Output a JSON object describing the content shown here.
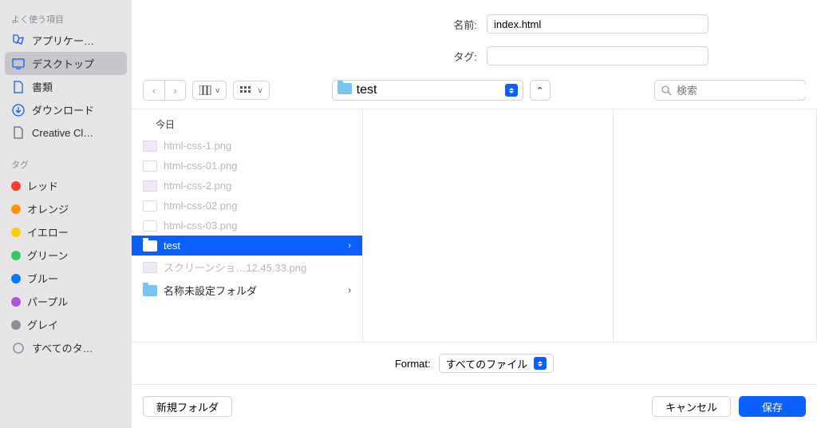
{
  "form": {
    "name_label": "名前:",
    "name_value": "index.html",
    "tag_label": "タグ:"
  },
  "sidebar": {
    "favorites_title": "よく使う項目",
    "favorites": [
      {
        "label": "アプリケー…",
        "icon": "app"
      },
      {
        "label": "デスクトップ",
        "icon": "desktop",
        "selected": true
      },
      {
        "label": "書類",
        "icon": "doc"
      },
      {
        "label": "ダウンロード",
        "icon": "download"
      },
      {
        "label": "Creative Cl…",
        "icon": "file"
      }
    ],
    "tags_title": "タグ",
    "tags": [
      {
        "label": "レッド",
        "color": "#ff3b30"
      },
      {
        "label": "オレンジ",
        "color": "#ff9500"
      },
      {
        "label": "イエロー",
        "color": "#ffcc00"
      },
      {
        "label": "グリーン",
        "color": "#34c759"
      },
      {
        "label": "ブルー",
        "color": "#007aff"
      },
      {
        "label": "パープル",
        "color": "#af52de"
      },
      {
        "label": "グレイ",
        "color": "#8e8e93"
      }
    ],
    "all_tags_label": "すべてのタ…"
  },
  "toolbar": {
    "location": "test",
    "search_placeholder": "検索"
  },
  "browser": {
    "header": "今日",
    "files": [
      {
        "name": "html-css-1.png",
        "type": "img",
        "dim": true
      },
      {
        "name": "html-css-01.png",
        "type": "imgw",
        "dim": true
      },
      {
        "name": "html-css-2.png",
        "type": "img",
        "dim": true
      },
      {
        "name": "html-css-02.png",
        "type": "imgw",
        "dim": true
      },
      {
        "name": "html-css-03.png",
        "type": "imgw",
        "dim": true
      },
      {
        "name": "test",
        "type": "folder",
        "selected": true
      },
      {
        "name": "スクリーンショ…12.45.33.png",
        "type": "img",
        "dim": true
      },
      {
        "name": "名称未設定フォルダ",
        "type": "folder"
      }
    ]
  },
  "format": {
    "label": "Format:",
    "value": "すべてのファイル"
  },
  "footer": {
    "new_folder": "新規フォルダ",
    "cancel": "キャンセル",
    "save": "保存"
  }
}
